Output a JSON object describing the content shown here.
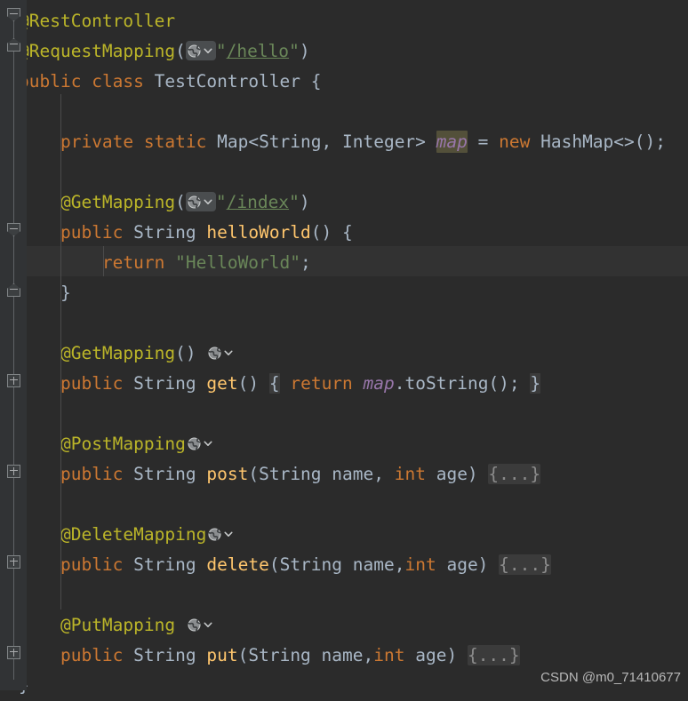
{
  "editor": {
    "theme": "Darcula",
    "language": "Java",
    "colors": {
      "background": "#2b2b2b",
      "gutter_background": "#313335",
      "current_line": "#323232",
      "keyword": "#cc7832",
      "annotation": "#bbb529",
      "method": "#ffc66d",
      "string": "#6a8759",
      "field": "#9876aa",
      "identifier": "#a9b7c6",
      "fold_placeholder_bg": "#3b3b3b",
      "identifier_highlight_bg": "#53503a"
    }
  },
  "code_lines": [
    {
      "n": 1,
      "gutter": "collapse-fold-icon",
      "tokens": [
        {
          "t": "@RestController",
          "c": "ann"
        }
      ]
    },
    {
      "n": 2,
      "gutter": "region-top-fold-icon",
      "tokens": [
        {
          "t": "@RequestMapping",
          "c": "ann"
        },
        {
          "t": "(",
          "c": "punc"
        },
        {
          "t": "web-mapping-icon",
          "c": "icon"
        },
        {
          "t": "\"",
          "c": "str"
        },
        {
          "t": "/hello",
          "c": "strlnk"
        },
        {
          "t": "\"",
          "c": "str"
        },
        {
          "t": ")",
          "c": "punc"
        }
      ]
    },
    {
      "n": 3,
      "tokens": [
        {
          "t": "public",
          "c": "kw"
        },
        {
          "t": " ",
          "c": "plain"
        },
        {
          "t": "class",
          "c": "kw"
        },
        {
          "t": " ",
          "c": "plain"
        },
        {
          "t": "TestController",
          "c": "type"
        },
        {
          "t": " {",
          "c": "punc"
        }
      ]
    },
    {
      "n": 4,
      "tokens": []
    },
    {
      "n": 5,
      "tokens": [
        {
          "t": "    ",
          "c": "plain"
        },
        {
          "t": "private",
          "c": "kw"
        },
        {
          "t": " ",
          "c": "plain"
        },
        {
          "t": "static",
          "c": "kw"
        },
        {
          "t": " ",
          "c": "plain"
        },
        {
          "t": "Map<String, Integer> ",
          "c": "type"
        },
        {
          "t": "map",
          "c": "field-hl"
        },
        {
          "t": " = ",
          "c": "punc"
        },
        {
          "t": "new",
          "c": "kw"
        },
        {
          "t": " ",
          "c": "plain"
        },
        {
          "t": "HashMap<>();",
          "c": "type"
        }
      ]
    },
    {
      "n": 6,
      "tokens": []
    },
    {
      "n": 7,
      "tokens": [
        {
          "t": "    ",
          "c": "plain"
        },
        {
          "t": "@GetMapping",
          "c": "ann"
        },
        {
          "t": "(",
          "c": "punc"
        },
        {
          "t": "web-mapping-icon",
          "c": "icon"
        },
        {
          "t": "\"",
          "c": "str"
        },
        {
          "t": "/index",
          "c": "strlnk"
        },
        {
          "t": "\"",
          "c": "str"
        },
        {
          "t": ")",
          "c": "punc"
        }
      ]
    },
    {
      "n": 8,
      "gutter": "collapse-fold-icon",
      "tokens": [
        {
          "t": "    ",
          "c": "plain"
        },
        {
          "t": "public",
          "c": "kw"
        },
        {
          "t": " ",
          "c": "plain"
        },
        {
          "t": "String",
          "c": "type"
        },
        {
          "t": " ",
          "c": "plain"
        },
        {
          "t": "helloWorld",
          "c": "meth"
        },
        {
          "t": "() {",
          "c": "punc"
        }
      ]
    },
    {
      "n": 9,
      "highlight": true,
      "tokens": [
        {
          "t": "        ",
          "c": "plain"
        },
        {
          "t": "return",
          "c": "kw"
        },
        {
          "t": " ",
          "c": "plain"
        },
        {
          "t": "\"HelloWorld\"",
          "c": "str"
        },
        {
          "t": ";",
          "c": "punc"
        }
      ]
    },
    {
      "n": 10,
      "gutter": "region-top-fold-icon",
      "tokens": [
        {
          "t": "    }",
          "c": "punc"
        }
      ]
    },
    {
      "n": 11,
      "tokens": []
    },
    {
      "n": 12,
      "tokens": [
        {
          "t": "    ",
          "c": "plain"
        },
        {
          "t": "@GetMapping",
          "c": "ann"
        },
        {
          "t": "()",
          "c": "punc"
        },
        {
          "t": " ",
          "c": "plain"
        },
        {
          "t": "web-mapping-icon-flat",
          "c": "icon"
        }
      ]
    },
    {
      "n": 13,
      "gutter": "expand-fold-icon",
      "tokens": [
        {
          "t": "    ",
          "c": "plain"
        },
        {
          "t": "public",
          "c": "kw"
        },
        {
          "t": " ",
          "c": "plain"
        },
        {
          "t": "String",
          "c": "type"
        },
        {
          "t": " ",
          "c": "plain"
        },
        {
          "t": "get",
          "c": "meth"
        },
        {
          "t": "()",
          "c": "punc"
        },
        {
          "t": " ",
          "c": "plain"
        },
        {
          "t": "{",
          "c": "brace-hl"
        },
        {
          "t": " ",
          "c": "plain"
        },
        {
          "t": "return",
          "c": "kw"
        },
        {
          "t": " ",
          "c": "plain"
        },
        {
          "t": "map",
          "c": "field"
        },
        {
          "t": ".toString();",
          "c": "punc"
        },
        {
          "t": " ",
          "c": "plain"
        },
        {
          "t": "}",
          "c": "brace-hl"
        }
      ]
    },
    {
      "n": 14,
      "tokens": []
    },
    {
      "n": 15,
      "tokens": [
        {
          "t": "    ",
          "c": "plain"
        },
        {
          "t": "@PostMapping",
          "c": "ann"
        },
        {
          "t": "web-mapping-icon-flat",
          "c": "icon"
        }
      ]
    },
    {
      "n": 16,
      "gutter": "expand-fold-icon",
      "tokens": [
        {
          "t": "    ",
          "c": "plain"
        },
        {
          "t": "public",
          "c": "kw"
        },
        {
          "t": " ",
          "c": "plain"
        },
        {
          "t": "String",
          "c": "type"
        },
        {
          "t": " ",
          "c": "plain"
        },
        {
          "t": "post",
          "c": "meth"
        },
        {
          "t": "(",
          "c": "punc"
        },
        {
          "t": "String",
          "c": "type"
        },
        {
          "t": " name, ",
          "c": "plain"
        },
        {
          "t": "int",
          "c": "kw"
        },
        {
          "t": " age) ",
          "c": "plain"
        },
        {
          "t": "{...}",
          "c": "fold-hl"
        }
      ]
    },
    {
      "n": 17,
      "tokens": []
    },
    {
      "n": 18,
      "tokens": [
        {
          "t": "    ",
          "c": "plain"
        },
        {
          "t": "@DeleteMapping",
          "c": "ann"
        },
        {
          "t": "web-mapping-icon-flat",
          "c": "icon"
        }
      ]
    },
    {
      "n": 19,
      "gutter": "expand-fold-icon",
      "tokens": [
        {
          "t": "    ",
          "c": "plain"
        },
        {
          "t": "public",
          "c": "kw"
        },
        {
          "t": " ",
          "c": "plain"
        },
        {
          "t": "String",
          "c": "type"
        },
        {
          "t": " ",
          "c": "plain"
        },
        {
          "t": "delete",
          "c": "meth"
        },
        {
          "t": "(",
          "c": "punc"
        },
        {
          "t": "String",
          "c": "type"
        },
        {
          "t": " name,",
          "c": "plain"
        },
        {
          "t": "int",
          "c": "kw"
        },
        {
          "t": " age) ",
          "c": "plain"
        },
        {
          "t": "{...}",
          "c": "fold-hl"
        }
      ]
    },
    {
      "n": 20,
      "tokens": []
    },
    {
      "n": 21,
      "tokens": [
        {
          "t": "    ",
          "c": "plain"
        },
        {
          "t": "@PutMapping",
          "c": "ann"
        },
        {
          "t": " ",
          "c": "plain"
        },
        {
          "t": "web-mapping-icon-flat",
          "c": "icon"
        }
      ]
    },
    {
      "n": 22,
      "gutter": "expand-fold-icon",
      "tokens": [
        {
          "t": "    ",
          "c": "plain"
        },
        {
          "t": "public",
          "c": "kw"
        },
        {
          "t": " ",
          "c": "plain"
        },
        {
          "t": "String",
          "c": "type"
        },
        {
          "t": " ",
          "c": "plain"
        },
        {
          "t": "put",
          "c": "meth"
        },
        {
          "t": "(",
          "c": "punc"
        },
        {
          "t": "String",
          "c": "type"
        },
        {
          "t": " name,",
          "c": "plain"
        },
        {
          "t": "int",
          "c": "kw"
        },
        {
          "t": " age) ",
          "c": "plain"
        },
        {
          "t": "{...}",
          "c": "fold-hl"
        }
      ]
    },
    {
      "n": 23,
      "tokens": [
        {
          "t": "}",
          "c": "punc"
        }
      ]
    }
  ],
  "watermark": {
    "text": "CSDN @m0_71410677"
  }
}
